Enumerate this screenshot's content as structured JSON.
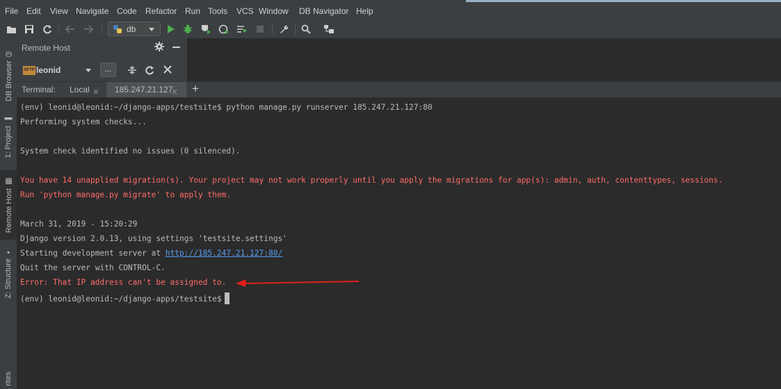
{
  "menu": [
    "File",
    "Edit",
    "View",
    "Navigate",
    "Code",
    "Refactor",
    "Run",
    "Tools",
    "VCS",
    "Window",
    "DB Navigator",
    "Help"
  ],
  "toolbar": {
    "run_config": "db",
    "icons": [
      "open-folder-icon",
      "save-icon",
      "sync-icon",
      "back-icon",
      "forward-icon",
      "python-icon",
      "run-icon",
      "debug-icon",
      "coverage-icon",
      "profile-icon",
      "run-tests-icon",
      "stop-icon",
      "wrench-icon",
      "search-icon",
      "vcs-icon"
    ]
  },
  "left_strip": {
    "tabs": [
      "DB Browser",
      "1: Project",
      "Remote Host",
      "Z: Structure",
      "rites"
    ]
  },
  "remote_host": {
    "title": "Remote Host",
    "host": "leonid",
    "badge": "SFTP",
    "browse_button": "..."
  },
  "terminal": {
    "label": "Terminal:",
    "tabs": [
      "Local",
      "185.247.21.127"
    ],
    "add": "+",
    "lines": [
      {
        "text": "(env) leonid@leonid:~/django-apps/testsite$ python manage.py runserver 185.247.21.127:80",
        "type": "normal"
      },
      {
        "text": "Performing system checks...",
        "type": "normal"
      },
      {
        "text": "",
        "type": "normal"
      },
      {
        "text": "System check identified no issues (0 silenced).",
        "type": "normal"
      },
      {
        "text": "",
        "type": "normal"
      },
      {
        "text": "You have 14 unapplied migration(s). Your project may not work properly until you apply the migrations for app(s): admin, auth, contenttypes, sessions.",
        "type": "red"
      },
      {
        "text": "Run 'python manage.py migrate' to apply them.",
        "type": "red"
      },
      {
        "text": "",
        "type": "normal"
      },
      {
        "text": "March 31, 2019 - 15:20:29",
        "type": "normal"
      },
      {
        "text": "Django version 2.0.13, using settings 'testsite.settings'",
        "type": "normal"
      },
      {
        "text": "Starting development server at ",
        "type": "normal",
        "link": "http://185.247.21.127:80/"
      },
      {
        "text": "Quit the server with CONTROL-C.",
        "type": "normal"
      },
      {
        "text": "Error: That IP address can't be assigned to.",
        "type": "red"
      },
      {
        "text": "(env) leonid@leonid:~/django-apps/testsite$",
        "type": "normal",
        "cursor": true
      }
    ]
  },
  "colors": {
    "background": "#2b2b2b",
    "panel": "#3c3f41",
    "text": "#bbbbbb",
    "error": "#ff6b68",
    "link": "#589df6",
    "arrow": "#e0201b",
    "run": "#4bb04f"
  }
}
